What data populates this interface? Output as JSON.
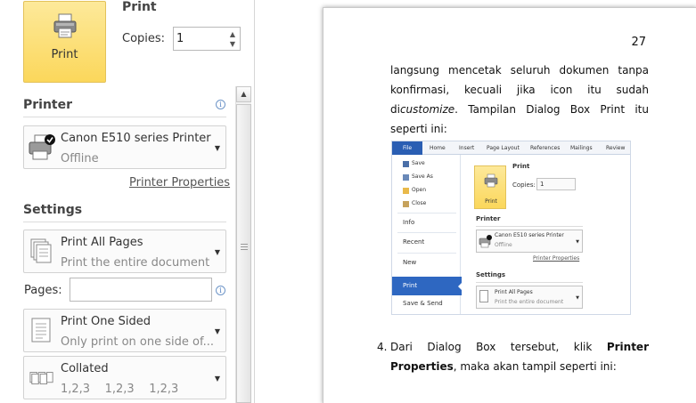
{
  "print_panel": {
    "print_button_label": "Print",
    "section_title": "Print",
    "copies_label": "Copies:",
    "copies_value": "1"
  },
  "printer": {
    "section_title": "Printer",
    "name": "Canon E510 series Printer",
    "status": "Offline",
    "properties_link": "Printer Properties"
  },
  "settings": {
    "section_title": "Settings",
    "pages_label": "Pages:",
    "pages_value": "",
    "print_range": {
      "main": "Print All Pages",
      "sub": "Print the entire document"
    },
    "sides": {
      "main": "Print One Sided",
      "sub": "Only print on one side of..."
    },
    "collation": {
      "main": "Collated",
      "sub": "1,2,3    1,2,3    1,2,3"
    }
  },
  "document": {
    "page_number": "27",
    "paragraph1_pre": "langsung mencetak seluruh dokumen tanpa konfirmasi, kecuali jika icon itu sudah di",
    "paragraph1_italic": "customize",
    "paragraph1_post": ". Tampilan Dialog Box Print itu seperti ini:",
    "paragraph2_num": "4.",
    "paragraph2_pre": "Dari Dialog Box tersebut, klik ",
    "paragraph2_bold": "Printer Properties",
    "paragraph2_post": ", maka akan tampil seperti ini:"
  },
  "embedded_screenshot": {
    "ribbon_tabs": [
      "File",
      "Home",
      "Insert",
      "Page Layout",
      "References",
      "Mailings",
      "Review"
    ],
    "nav_small": [
      "Save",
      "Save As",
      "Open",
      "Close"
    ],
    "nav_items": [
      "Info",
      "Recent",
      "New",
      "Print",
      "Save & Send"
    ],
    "print_button_label": "Print",
    "print_title": "Print",
    "copies_label": "Copies:",
    "copies_value": "1",
    "printer_title": "Printer",
    "printer_name": "Canon E510 series Printer",
    "printer_status": "Offline",
    "printer_properties": "Printer Properties",
    "settings_title": "Settings",
    "range_main": "Print All Pages",
    "range_sub": "Print the entire document"
  },
  "colors": {
    "print_button": "#fbd75b",
    "accent_blue": "#2e67c1",
    "file_tab": "#2a5eb3"
  }
}
